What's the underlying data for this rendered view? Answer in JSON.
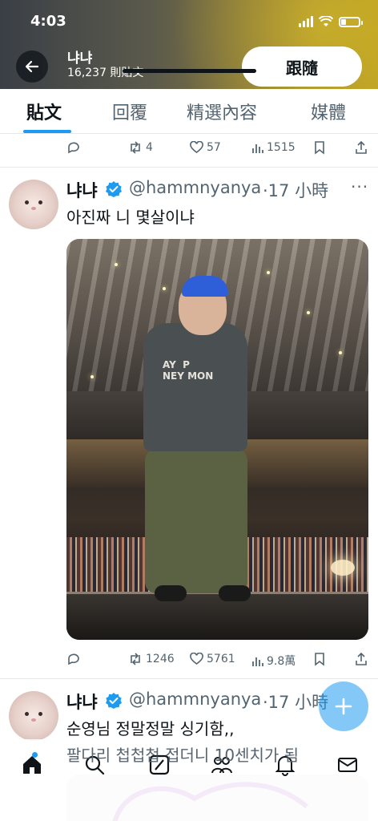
{
  "status_bar": {
    "time": "4:03"
  },
  "header": {
    "name": "냐냐",
    "post_count": "16,237 則貼文",
    "follow_label": "跟隨",
    "colors": {
      "banner_left": "#3a3f46",
      "banner_right": "#b59a24"
    }
  },
  "tabs": [
    {
      "label": "貼文",
      "active": true
    },
    {
      "label": "回覆",
      "active": false
    },
    {
      "label": "精選內容",
      "active": false
    },
    {
      "label": "媒體",
      "active": false
    }
  ],
  "prev_tweet_actions": {
    "replies": "",
    "retweets": "4",
    "likes": "57",
    "views": "1515"
  },
  "tweets": [
    {
      "name": "냐냐",
      "handle": "@hammnyanya",
      "time": "·17 小時",
      "text": "아진짜 니 몇살이냐",
      "media": {
        "shirt_text": "AY  P\nNEY MON"
      },
      "actions": {
        "replies": "",
        "retweets": "1246",
        "likes": "5761",
        "views": "9.8萬"
      }
    },
    {
      "name": "냐냐",
      "handle": "@hammnyanya",
      "time": "·17 小時",
      "text_lines": [
        "순영님 정말정말 싱기함,,",
        "팔다리 첩첩첩 접더니 10센치가 됨"
      ]
    }
  ],
  "accent_color": "#1d9bf0",
  "icons": [
    "back-arrow-icon",
    "reply-icon",
    "retweet-icon",
    "like-icon",
    "views-icon",
    "bookmark-icon",
    "share-icon",
    "verified-icon",
    "more-icon",
    "compose-plus-icon",
    "home-icon",
    "search-icon",
    "grok-icon",
    "communities-icon",
    "notifications-icon",
    "messages-icon"
  ]
}
